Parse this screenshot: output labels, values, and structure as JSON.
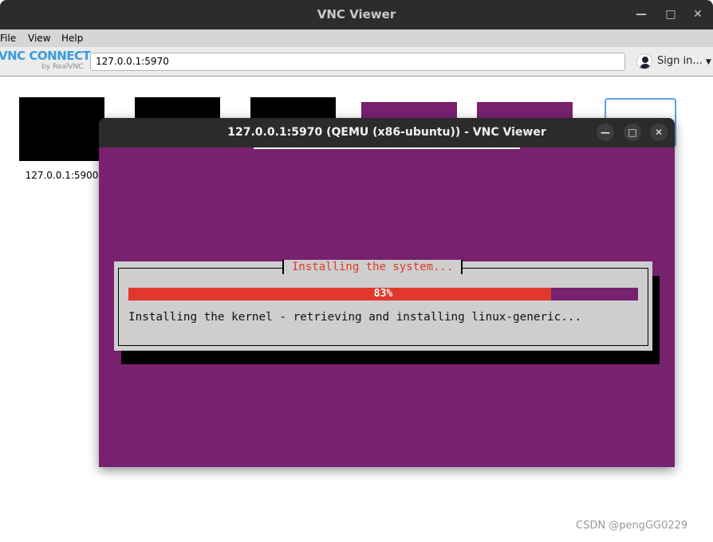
{
  "window": {
    "title": "VNC Viewer",
    "controls": [
      "minimize",
      "maximize",
      "close"
    ]
  },
  "menu": {
    "file": "File",
    "view": "View",
    "help": "Help"
  },
  "toolbar": {
    "logo": "VNC CONNECT",
    "logo_sub": "by RealVNC",
    "address_value": "127.0.0.1:5970",
    "sign_in": "Sign in..."
  },
  "thumbnails": [
    {
      "label": "127.0.0.1:5900"
    }
  ],
  "session": {
    "title": "127.0.0.1:5970 (QEMU (x86-ubuntu)) - VNC Viewer",
    "dialog_title": "Installing the system...",
    "progress_percent": 83,
    "progress_label": "83%",
    "status": "Installing the kernel - retrieving and installing linux-generic..."
  },
  "colors": {
    "ubuntu_purple": "#77216f",
    "progress_red": "#e0382b",
    "dialog_gray": "#cecece"
  },
  "watermark": "CSDN @pengGG0229"
}
